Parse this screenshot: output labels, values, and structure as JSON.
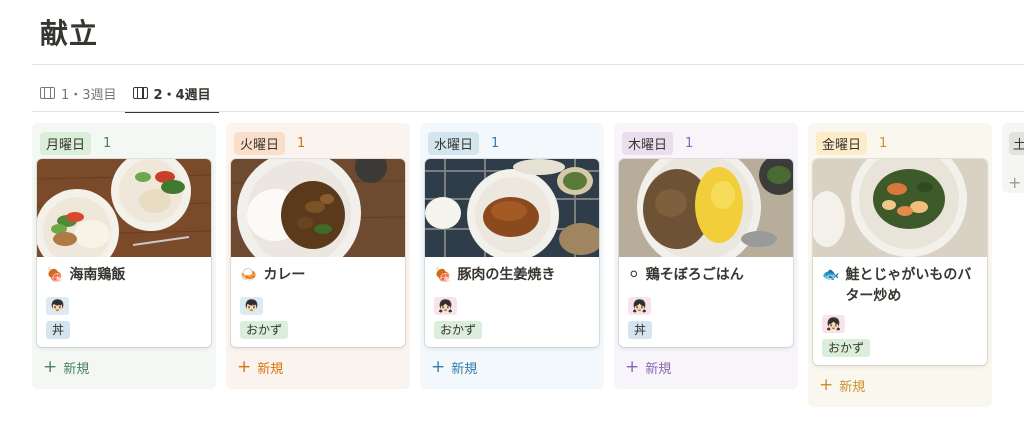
{
  "page": {
    "title": "献立"
  },
  "tabs": [
    {
      "label": "1・3週目",
      "icon": "board-view-icon",
      "active": false
    },
    {
      "label": "2・4週目",
      "icon": "board-view-icon",
      "active": true
    }
  ],
  "columns": [
    {
      "name": "月曜日",
      "count": "1",
      "new_label": "新規",
      "card": {
        "emoji": "🍖",
        "title": "海南鶏飯",
        "avatar": "👦🏻",
        "category": "丼"
      }
    },
    {
      "name": "火曜日",
      "count": "1",
      "new_label": "新規",
      "card": {
        "emoji": "🍛",
        "title": "カレー",
        "avatar": "👦🏻",
        "category": "おかず"
      }
    },
    {
      "name": "水曜日",
      "count": "1",
      "new_label": "新規",
      "card": {
        "emoji": "🍖",
        "title": "豚肉の生姜焼き",
        "avatar": "👧🏻",
        "category": "おかず"
      }
    },
    {
      "name": "木曜日",
      "count": "1",
      "new_label": "新規",
      "card": {
        "emoji": "⚪",
        "title": "鶏そぼろごはん",
        "avatar": "👧🏻",
        "category": "丼"
      }
    },
    {
      "name": "金曜日",
      "count": "1",
      "new_label": "新規",
      "card": {
        "emoji": "🐟",
        "title": "鮭とじゃがいものバター炒め",
        "avatar": "👧🏻",
        "category": "おかず"
      }
    },
    {
      "name": "土",
      "new_label": "+"
    }
  ],
  "colors": {
    "monday": "#448361",
    "tuesday": "#d9730d",
    "wednesday": "#337ea9",
    "thursday": "#9065b0",
    "friday": "#cb912f"
  }
}
